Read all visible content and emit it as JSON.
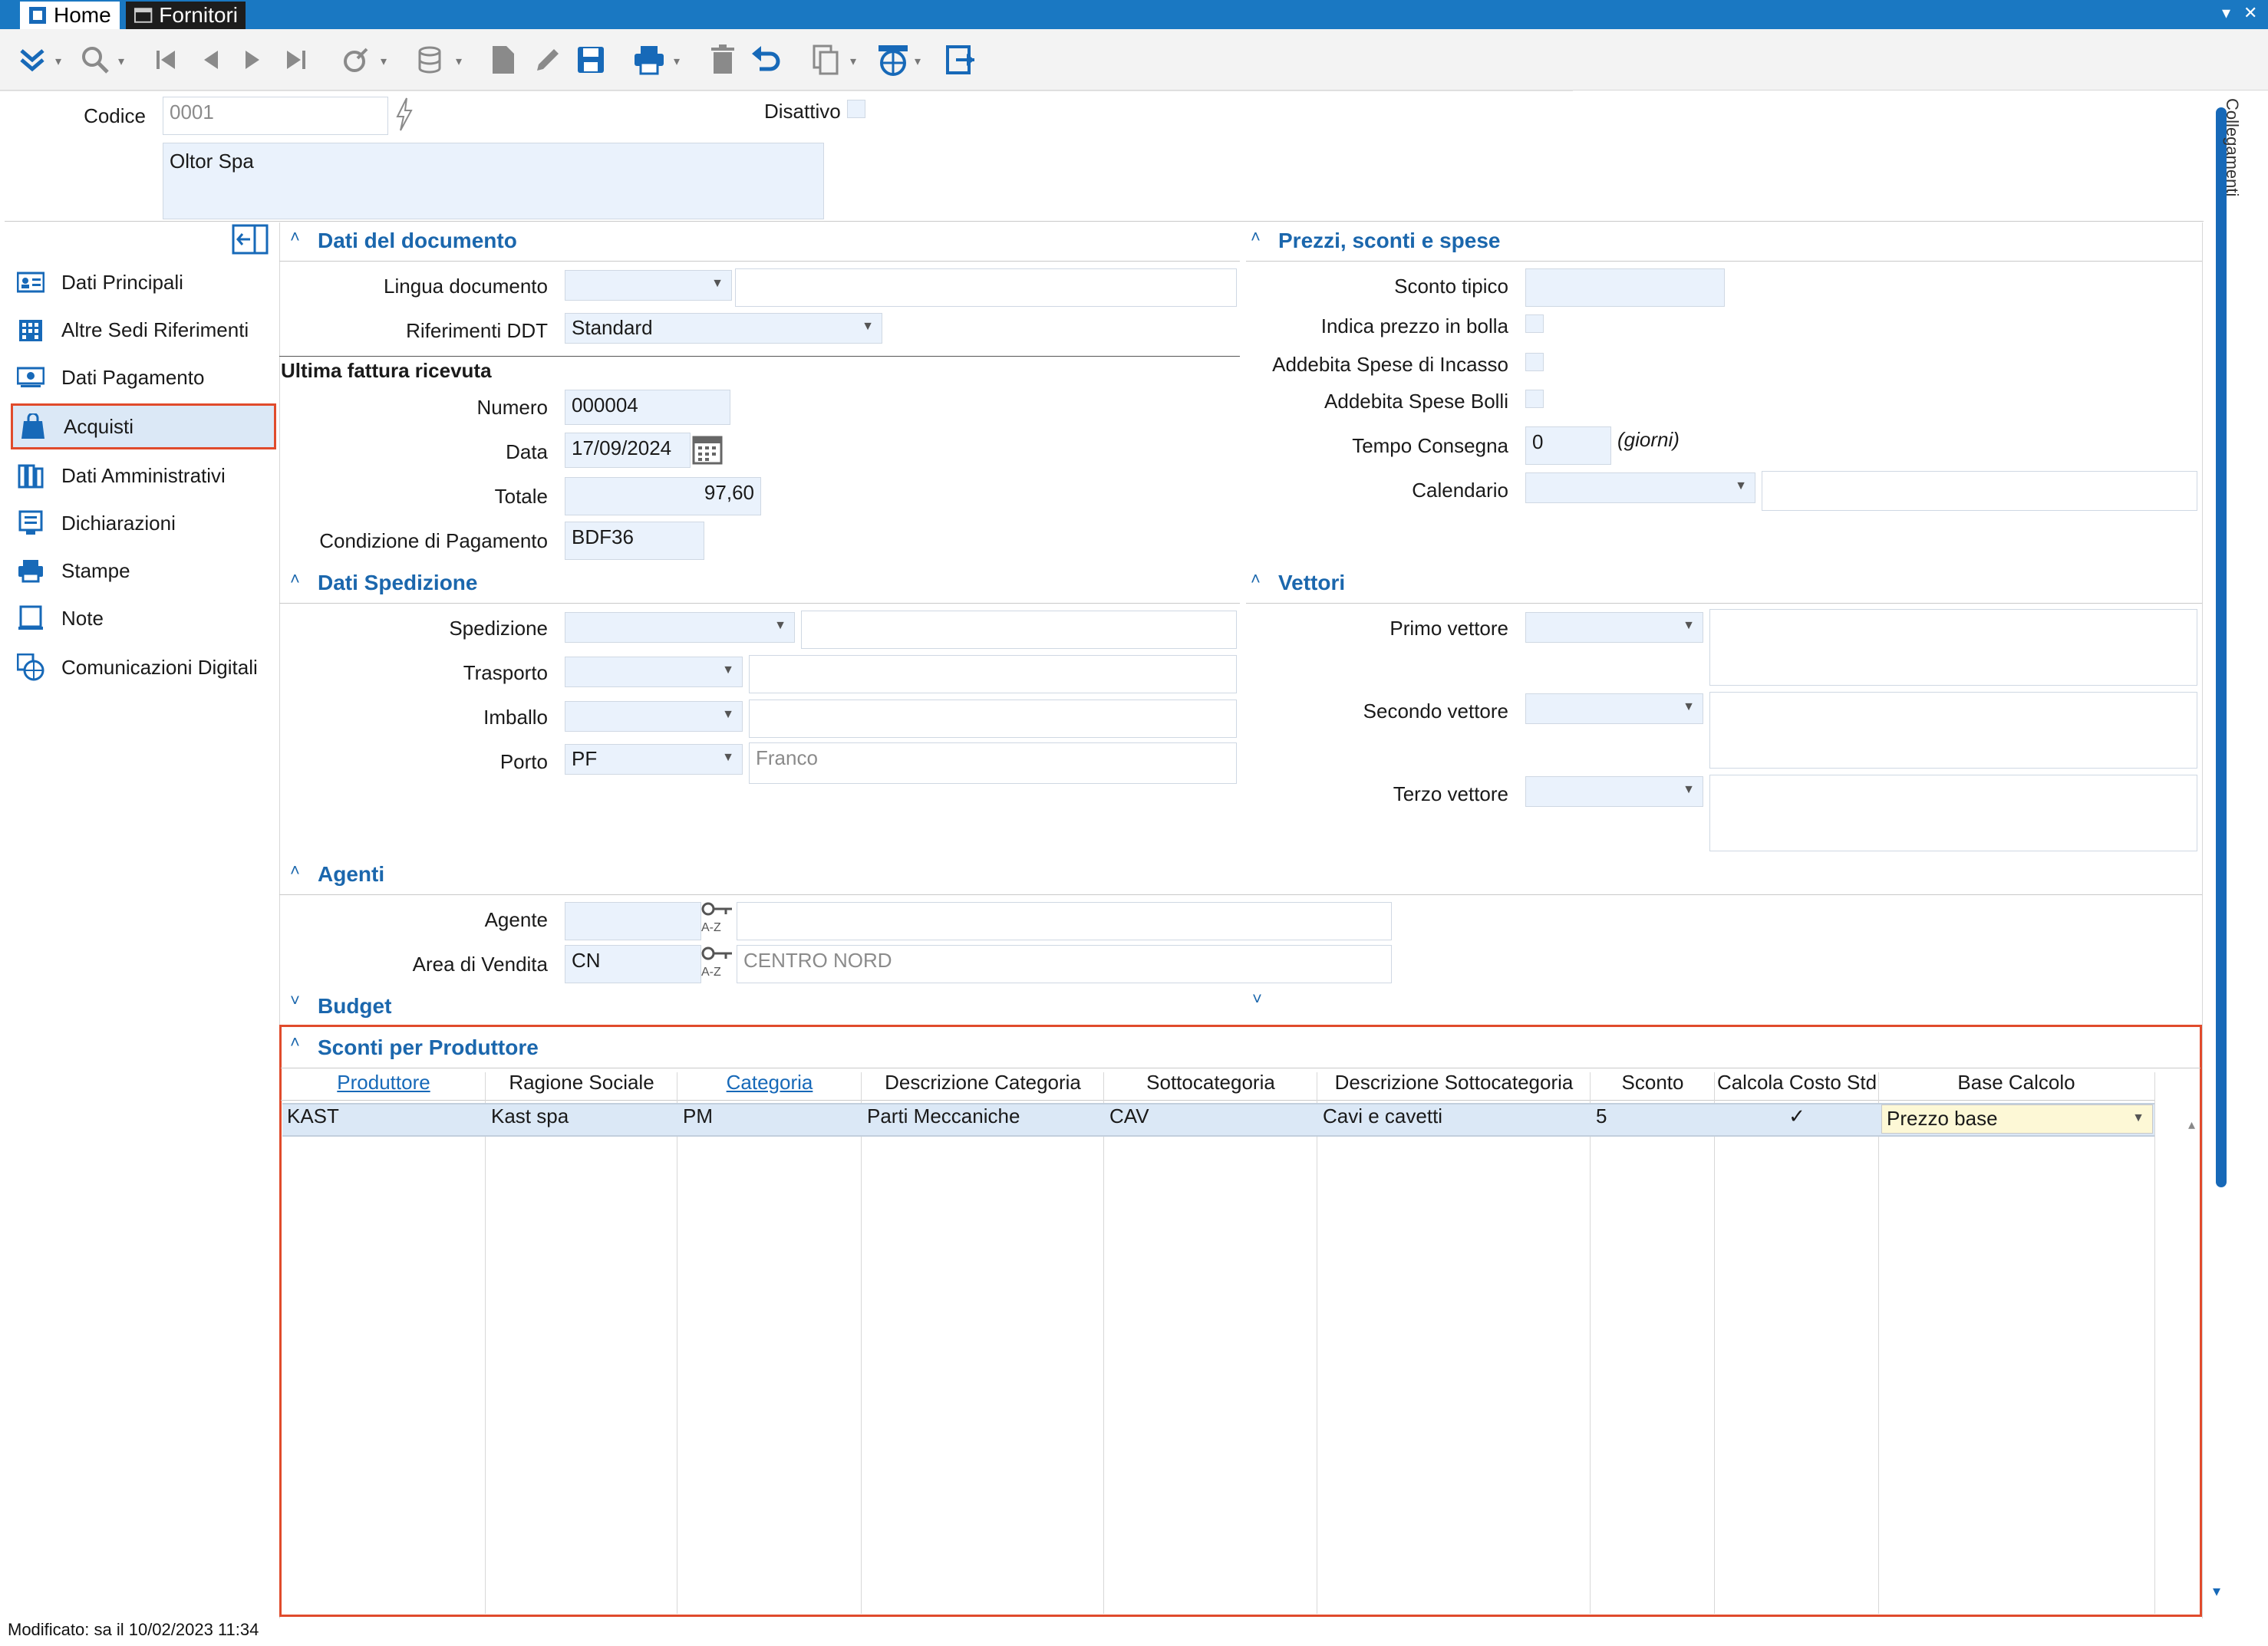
{
  "window": {
    "tabs": [
      "Home",
      "Fornitori"
    ]
  },
  "header": {
    "codice_label": "Codice",
    "codice_value": "0001",
    "ragione_sociale": "Oltor Spa",
    "disattivo_label": "Disattivo"
  },
  "sidebar": {
    "items": [
      {
        "label": "Dati Principali",
        "icon": "id-card-icon"
      },
      {
        "label": "Altre Sedi Riferimenti",
        "icon": "building-icon"
      },
      {
        "label": "Dati Pagamento",
        "icon": "money-icon"
      },
      {
        "label": "Acquisti",
        "icon": "shopping-bag-icon"
      },
      {
        "label": "Dati Amministrativi",
        "icon": "books-icon"
      },
      {
        "label": "Dichiarazioni",
        "icon": "declaration-icon"
      },
      {
        "label": "Stampe",
        "icon": "printer-icon"
      },
      {
        "label": "Note",
        "icon": "note-icon"
      },
      {
        "label": "Comunicazioni Digitali",
        "icon": "globe-icon"
      }
    ],
    "active_index": 3
  },
  "dati_documento": {
    "title": "Dati del documento",
    "lingua_label": "Lingua documento",
    "riferimenti_label": "Riferimenti DDT",
    "riferimenti_value": "Standard",
    "ultima_fattura": "Ultima fattura ricevuta",
    "numero_label": "Numero",
    "numero_value": "000004",
    "data_label": "Data",
    "data_value": "17/09/2024",
    "totale_label": "Totale",
    "totale_value": "97,60",
    "condizione_label": "Condizione di Pagamento",
    "condizione_value": "BDF36"
  },
  "prezzi": {
    "title": "Prezzi, sconti e spese",
    "sconto_label": "Sconto tipico",
    "prezzo_bolla_label": "Indica prezzo in bolla",
    "spese_incasso_label": "Addebita Spese di Incasso",
    "spese_bolli_label": "Addebita Spese Bolli",
    "tempo_label": "Tempo Consegna",
    "tempo_value": "0",
    "tempo_unit": "(giorni)",
    "calendario_label": "Calendario"
  },
  "spedizione": {
    "title": "Dati Spedizione",
    "spedizione_label": "Spedizione",
    "trasporto_label": "Trasporto",
    "imballo_label": "Imballo",
    "porto_label": "Porto",
    "porto_value": "PF",
    "porto_desc": "Franco"
  },
  "vettori": {
    "title": "Vettori",
    "primo_label": "Primo vettore",
    "secondo_label": "Secondo vettore",
    "terzo_label": "Terzo vettore"
  },
  "agenti": {
    "title": "Agenti",
    "agente_label": "Agente",
    "area_label": "Area di Vendita",
    "area_value": "CN",
    "area_desc": "CENTRO NORD",
    "az_label": "A-Z"
  },
  "budget": {
    "title": "Budget"
  },
  "sconti": {
    "title": "Sconti per Produttore",
    "columns": [
      "Produttore",
      "Ragione Sociale",
      "Categoria",
      "Descrizione Categoria",
      "Sottocategoria",
      "Descrizione Sottocategoria",
      "Sconto",
      "Calcola Costo Std",
      "Base Calcolo"
    ],
    "rows": [
      [
        "KAST",
        "Kast spa",
        "PM",
        "Parti Meccaniche",
        "CAV",
        "Cavi e cavetti",
        "5",
        "✓",
        "Prezzo base"
      ]
    ]
  },
  "side_panel": "Collegamenti",
  "status": "Modificato: sa il 10/02/2023 11:34",
  "colors": {
    "accent": "#1769b8",
    "highlight": "#e04b2c",
    "field": "#eaf2fc"
  }
}
